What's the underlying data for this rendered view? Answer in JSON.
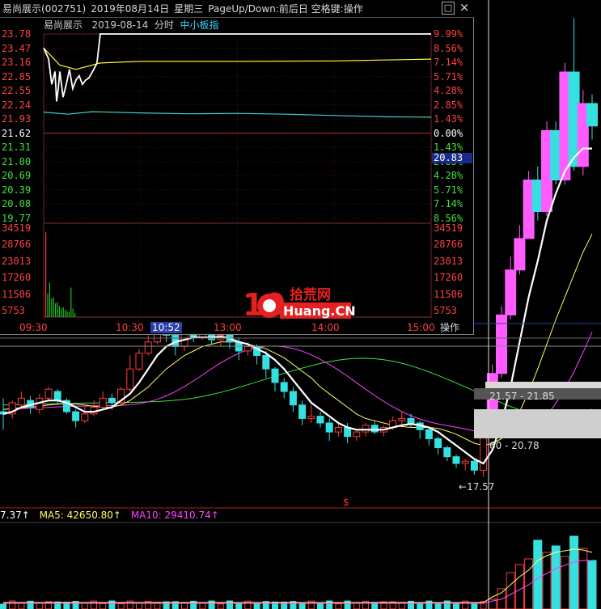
{
  "window": {
    "title_name": "易尚展示(002751)",
    "title_date": "2019年08月14日",
    "title_weekday": "星期三",
    "title_hint": "PageUp/Down:前后日 空格键:操作",
    "maximize": "□",
    "close": "×"
  },
  "subheader": {
    "name": "易尚展示",
    "date": "2019-08-14",
    "mode": "分时",
    "index": "中小板指"
  },
  "price_axis_left": [
    "23.78",
    "23.47",
    "23.16",
    "22.85",
    "22.55",
    "22.24",
    "21.93",
    "21.62",
    "21.31",
    "21.00",
    "20.69",
    "20.39",
    "20.08",
    "19.77"
  ],
  "pct_axis_right": [
    "9.99%",
    "8.56%",
    "7.14%",
    "5.71%",
    "4.28%",
    "2.85%",
    "1.43%",
    "0.00%",
    "1.43%",
    "2.85%",
    "4.28%",
    "5.71%",
    "7.14%",
    "8.56%"
  ],
  "vol_axis": [
    "34519",
    "28766",
    "23013",
    "17260",
    "11506",
    "5753"
  ],
  "current_price_tag": "20.83",
  "time_axis": [
    "09:30",
    "10:30",
    "10:52",
    "13:00",
    "14:00",
    "15:00"
  ],
  "operate_label": "操作",
  "watermark": {
    "big": "10",
    "cn": "拾荒网",
    "en": "Huang.CN"
  },
  "kline_tags": {
    "low": "17.57",
    "range1_a": "21.57",
    "range1_b": "21.85",
    "range2_a": "60",
    "range2_b": "20.78"
  },
  "marker": "$",
  "legend": {
    "vol": "7.37↑",
    "ma5": "MA5: 42650.80↑",
    "ma10": "MA10: 29410.74↑"
  },
  "colors": {
    "up": "#ff3b3b",
    "down": "#35e0e0",
    "magenta": "#ff5cff",
    "ma5": "#ffffff",
    "ma10": "#ffff60",
    "ma20": "#ff40ff",
    "ma60": "#40e040",
    "price_line": "#ffffff",
    "avg_line": "#ffff40",
    "index_line": "#40d0d0",
    "label_up": "#ff4040",
    "label_down": "#40e040",
    "label_neutral": "#ffffff",
    "label_vol": "#ff4040"
  },
  "intraday": {
    "prev_close": 21.62,
    "price_points": [
      [
        0,
        23.45
      ],
      [
        3,
        23.2
      ],
      [
        5,
        22.6
      ],
      [
        7,
        22.9
      ],
      [
        8,
        22.2
      ],
      [
        9,
        22.5
      ],
      [
        10,
        22.9
      ],
      [
        12,
        22.3
      ],
      [
        14,
        22.6
      ],
      [
        16,
        22.95
      ],
      [
        18,
        22.5
      ],
      [
        20,
        22.7
      ],
      [
        22,
        22.8
      ],
      [
        24,
        22.6
      ],
      [
        26,
        22.7
      ],
      [
        28,
        22.75
      ],
      [
        31,
        22.95
      ],
      [
        33,
        23.1
      ],
      [
        35,
        23.78
      ],
      [
        240,
        23.78
      ]
    ],
    "avg_points": [
      [
        0,
        23.45
      ],
      [
        10,
        23.05
      ],
      [
        20,
        22.95
      ],
      [
        35,
        23.1
      ],
      [
        60,
        23.14
      ],
      [
        120,
        23.14
      ],
      [
        180,
        23.15
      ],
      [
        240,
        23.19
      ]
    ],
    "index_points": [
      [
        0,
        21.95
      ],
      [
        15,
        21.9
      ],
      [
        30,
        21.96
      ],
      [
        60,
        21.93
      ],
      [
        90,
        21.91
      ],
      [
        120,
        21.92
      ],
      [
        150,
        21.9
      ],
      [
        180,
        21.87
      ],
      [
        210,
        21.84
      ],
      [
        240,
        21.83
      ]
    ],
    "volumes": [
      34519,
      9500,
      14000,
      7600,
      8000,
      5600,
      6000,
      4400,
      3500,
      4000,
      3000,
      2400,
      2000,
      12000,
      3500,
      1600
    ]
  },
  "kline": {
    "candles": [
      [
        18.05,
        18.0,
        18.35,
        17.65
      ],
      [
        18.0,
        18.25,
        18.3,
        17.9
      ],
      [
        18.2,
        18.35,
        18.5,
        18.1
      ],
      [
        18.3,
        18.15,
        18.4,
        18.0
      ],
      [
        18.1,
        18.35,
        18.45,
        18.0
      ],
      [
        18.35,
        18.55,
        18.6,
        18.3
      ],
      [
        18.5,
        18.3,
        18.55,
        18.2
      ],
      [
        18.3,
        18.05,
        18.35,
        18.0
      ],
      [
        18.05,
        17.85,
        18.1,
        17.7
      ],
      [
        17.85,
        18.0,
        18.2,
        17.8
      ],
      [
        18.0,
        18.15,
        18.3,
        17.95
      ],
      [
        18.15,
        18.35,
        18.5,
        18.1
      ],
      [
        18.35,
        18.25,
        18.45,
        18.1
      ],
      [
        18.25,
        18.55,
        18.6,
        18.2
      ],
      [
        18.55,
        19.0,
        19.3,
        18.5
      ],
      [
        19.0,
        19.35,
        19.45,
        18.95
      ],
      [
        19.35,
        19.6,
        19.75,
        19.3
      ],
      [
        19.6,
        19.95,
        20.0,
        19.55
      ],
      [
        19.95,
        19.75,
        20.05,
        19.6
      ],
      [
        19.75,
        19.5,
        19.85,
        19.3
      ],
      [
        19.5,
        19.8,
        19.9,
        19.4
      ],
      [
        19.8,
        19.7,
        19.95,
        19.6
      ],
      [
        19.7,
        19.85,
        19.95,
        19.65
      ],
      [
        19.85,
        19.65,
        19.9,
        19.55
      ],
      [
        19.65,
        19.75,
        19.8,
        19.5
      ],
      [
        19.75,
        19.6,
        19.8,
        19.45
      ],
      [
        19.6,
        19.4,
        19.7,
        19.2
      ],
      [
        19.4,
        19.5,
        19.6,
        19.3
      ],
      [
        19.5,
        19.3,
        19.55,
        19.1
      ],
      [
        19.3,
        19.0,
        19.4,
        18.8
      ],
      [
        19.0,
        18.7,
        19.05,
        18.5
      ],
      [
        18.7,
        18.5,
        18.8,
        18.35
      ],
      [
        18.5,
        18.2,
        18.6,
        18.05
      ],
      [
        18.2,
        17.9,
        18.3,
        17.75
      ],
      [
        17.9,
        17.95,
        18.2,
        17.8
      ],
      [
        17.95,
        17.8,
        18.05,
        17.7
      ],
      [
        17.8,
        17.6,
        17.9,
        17.4
      ],
      [
        17.6,
        17.7,
        17.8,
        17.5
      ],
      [
        17.7,
        17.5,
        17.8,
        17.35
      ],
      [
        17.5,
        17.6,
        17.65,
        17.4
      ],
      [
        17.6,
        17.75,
        17.8,
        17.5
      ],
      [
        17.75,
        17.6,
        17.85,
        17.55
      ],
      [
        17.6,
        17.7,
        17.75,
        17.5
      ],
      [
        17.7,
        17.85,
        17.95,
        17.65
      ],
      [
        17.85,
        17.9,
        18.05,
        17.75
      ],
      [
        17.9,
        17.8,
        18.0,
        17.7
      ],
      [
        17.8,
        17.65,
        17.85,
        17.45
      ],
      [
        17.65,
        17.45,
        17.7,
        17.3
      ],
      [
        17.45,
        17.25,
        17.5,
        17.1
      ],
      [
        17.25,
        17.05,
        17.3,
        16.95
      ],
      [
        17.05,
        16.9,
        17.1,
        16.8
      ],
      [
        16.9,
        16.95,
        17.0,
        16.75
      ],
      [
        16.95,
        16.75,
        17.0,
        16.65
      ],
      [
        16.75,
        17.57,
        17.6,
        16.6
      ],
      [
        17.57,
        18.9,
        19.1,
        17.57
      ],
      [
        18.9,
        20.2,
        20.4,
        18.8
      ],
      [
        20.2,
        21.2,
        21.5,
        20.1
      ],
      [
        21.2,
        21.9,
        22.2,
        21.1
      ],
      [
        21.9,
        23.2,
        23.4,
        21.9
      ],
      [
        23.2,
        22.5,
        23.5,
        22.3
      ],
      [
        22.5,
        24.3,
        24.5,
        22.4
      ],
      [
        24.3,
        23.2,
        24.5,
        23.1
      ],
      [
        23.2,
        25.6,
        25.8,
        23.1
      ],
      [
        25.6,
        23.5,
        26.8,
        23.4
      ],
      [
        23.5,
        24.9,
        25.2,
        23.3
      ],
      [
        24.9,
        24.4,
        25.1,
        24.1
      ]
    ],
    "ma5": [
      18.0,
      18.05,
      18.15,
      18.2,
      18.25,
      18.3,
      18.3,
      18.25,
      18.15,
      18.05,
      18.05,
      18.1,
      18.15,
      18.3,
      18.45,
      18.7,
      19.0,
      19.3,
      19.5,
      19.6,
      19.65,
      19.7,
      19.7,
      19.7,
      19.72,
      19.68,
      19.6,
      19.55,
      19.45,
      19.35,
      19.2,
      19.0,
      18.75,
      18.5,
      18.25,
      18.1,
      17.95,
      17.8,
      17.7,
      17.65,
      17.65,
      17.65,
      17.65,
      17.7,
      17.75,
      17.78,
      17.75,
      17.7,
      17.6,
      17.45,
      17.3,
      17.15,
      17.0,
      16.9,
      17.2,
      17.8,
      18.6,
      19.6,
      20.6,
      21.4,
      22.3,
      22.9,
      23.4,
      23.7,
      23.9,
      23.9
    ],
    "ma10": [
      18.1,
      18.12,
      18.14,
      18.15,
      18.17,
      18.2,
      18.22,
      18.23,
      18.22,
      18.2,
      18.17,
      18.15,
      18.15,
      18.2,
      18.3,
      18.45,
      18.6,
      18.8,
      19.0,
      19.15,
      19.3,
      19.4,
      19.5,
      19.55,
      19.6,
      19.6,
      19.6,
      19.55,
      19.5,
      19.45,
      19.35,
      19.25,
      19.1,
      18.95,
      18.8,
      18.6,
      18.45,
      18.3,
      18.15,
      18.0,
      17.9,
      17.85,
      17.8,
      17.75,
      17.72,
      17.7,
      17.7,
      17.7,
      17.68,
      17.62,
      17.55,
      17.45,
      17.35,
      17.3,
      17.35,
      17.45,
      17.7,
      18.05,
      18.5,
      19.0,
      19.55,
      20.1,
      20.6,
      21.1,
      21.6,
      22.0
    ]
  }
}
